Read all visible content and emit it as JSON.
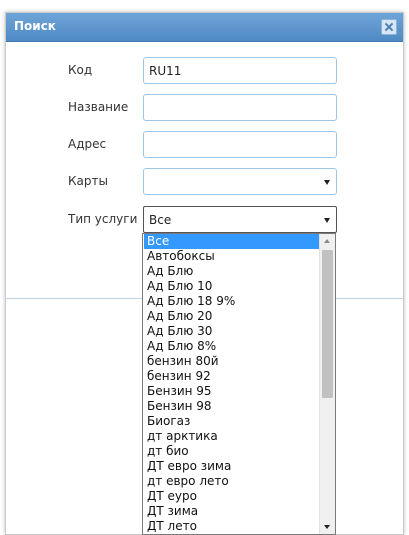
{
  "dialog": {
    "title": "Поиск",
    "close_icon": "close-icon"
  },
  "form": {
    "code": {
      "label": "Код",
      "value": "RU11"
    },
    "name": {
      "label": "Название",
      "value": ""
    },
    "address": {
      "label": "Адрес",
      "value": ""
    },
    "cards": {
      "label": "Карты",
      "value": ""
    },
    "service_type": {
      "label": "Тип услуги",
      "value": "Все"
    }
  },
  "dropdown": {
    "options": [
      "Все",
      "Автобоксы",
      "Ад Блю",
      "Ад Блю 10",
      "Ад Блю 18 9%",
      "Ад Блю 20",
      "Ад Блю 30",
      "Ад Блю 8%",
      "бензин 80й",
      "бензин 92",
      "Бензин 95",
      "Бензин 98",
      "Биогаз",
      "дт арктика",
      "дт био",
      "ДТ евро зима",
      "дт евро лето",
      "ДТ еуро",
      "ДТ зима",
      "ДТ лето"
    ],
    "selected_index": 0
  },
  "colors": {
    "title_bar": "#5a93cc",
    "input_border": "#9ec6e8",
    "selected_option": "#3399ff"
  }
}
